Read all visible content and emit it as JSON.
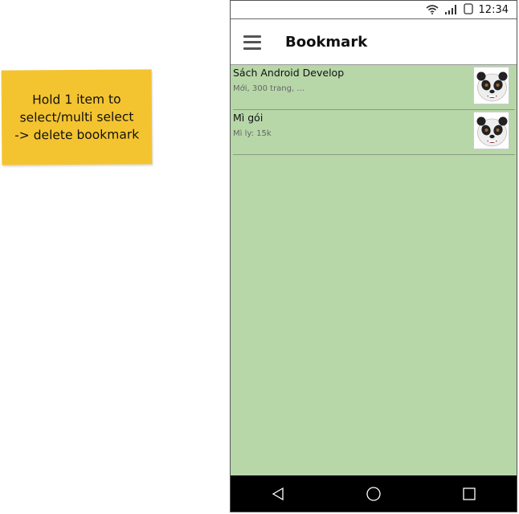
{
  "note": {
    "text": "Hold 1 item to\nselect/multi select\n-> delete bookmark"
  },
  "status_bar": {
    "time": "12:34",
    "icons": [
      "wifi-icon",
      "signal-icon",
      "battery-icon"
    ]
  },
  "app_bar": {
    "menu_icon": "hamburger-menu-icon",
    "title": "Bookmark"
  },
  "bookmarks": [
    {
      "title": "Sách Android Develop",
      "subtitle": "Mới, 300 trang, ...",
      "thumb_icon": "panda-avatar-icon"
    },
    {
      "title": "Mì gói",
      "subtitle": "Mì ly: 15k",
      "thumb_icon": "panda-avatar-icon"
    }
  ],
  "nav_bar": {
    "buttons": [
      "back-icon",
      "home-icon",
      "recents-icon"
    ]
  },
  "colors": {
    "sticky_note": "#f4c430",
    "list_background": "#b7d7a8",
    "nav_bar": "#000000"
  }
}
